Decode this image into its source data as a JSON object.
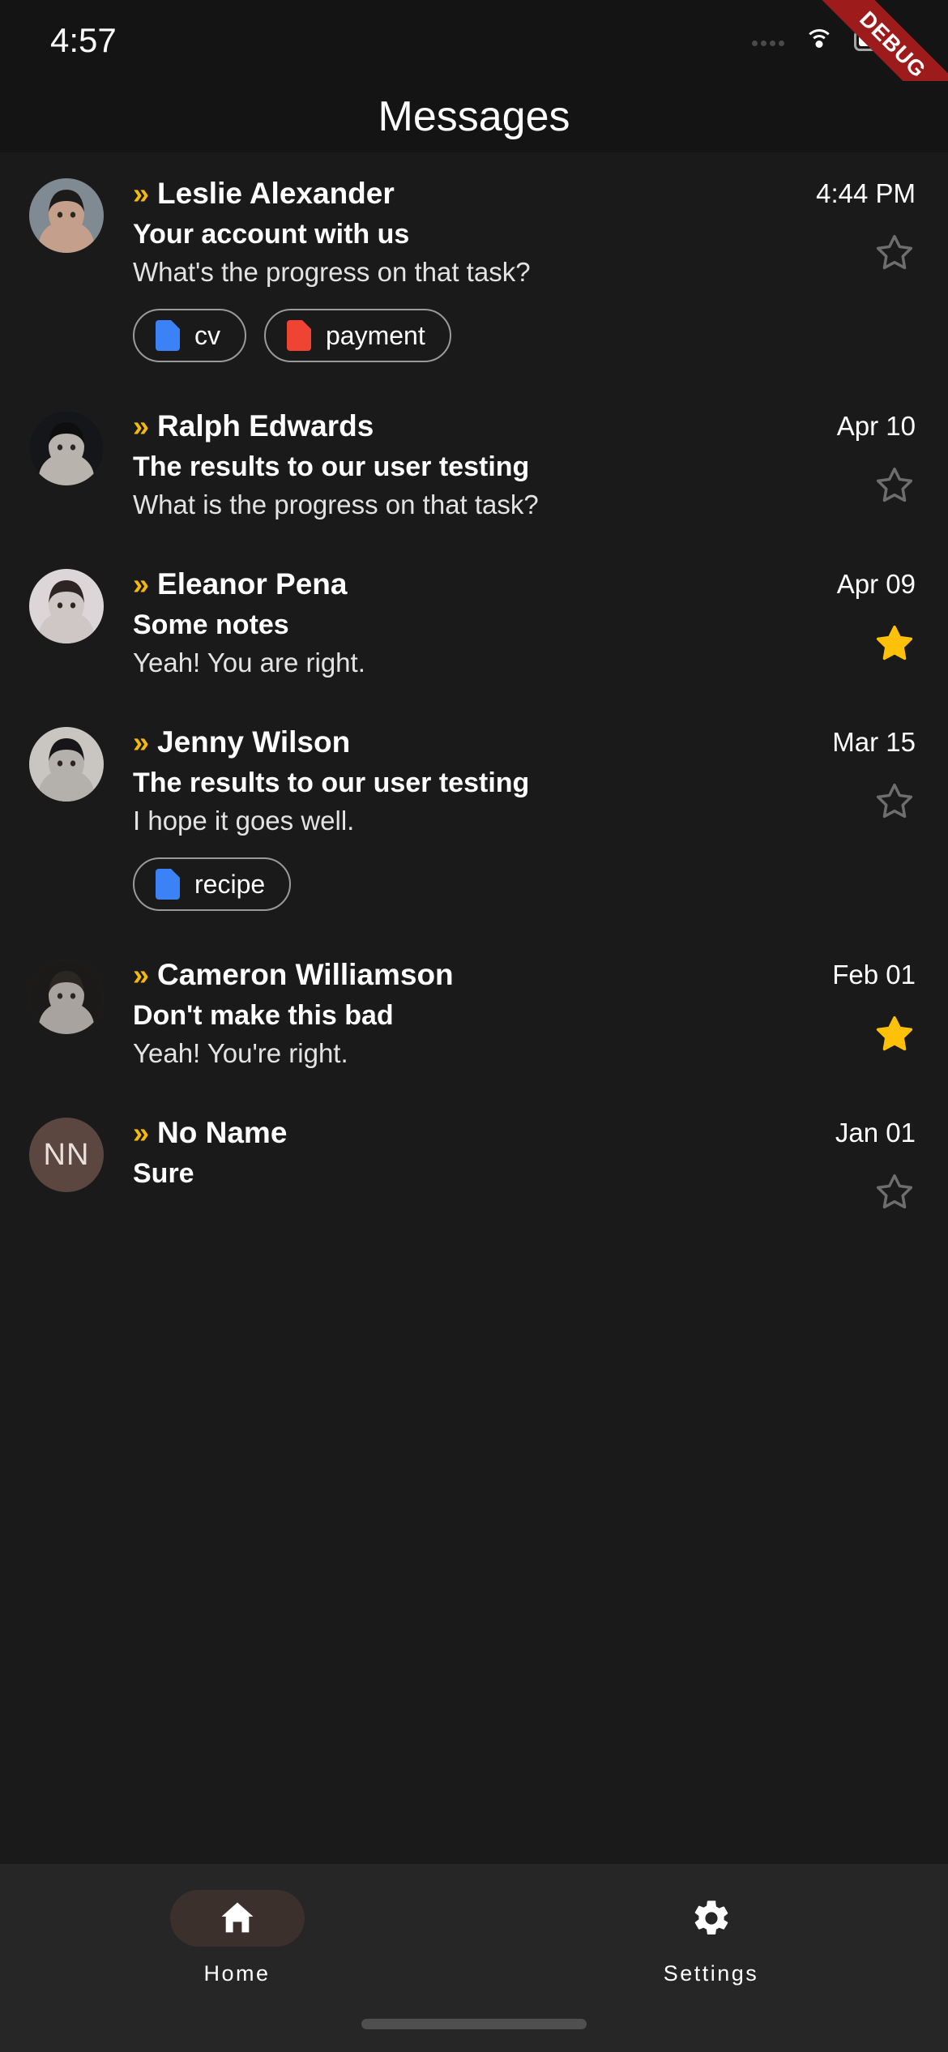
{
  "status_bar": {
    "time": "4:57",
    "icons": [
      "signal-dots",
      "wifi-icon",
      "battery-icon"
    ],
    "debug_banner": "DEBUG"
  },
  "app_bar": {
    "title": "Messages"
  },
  "messages": [
    {
      "avatar_type": "photo",
      "avatar_initials": "",
      "unread_icon": "»",
      "name": "Leslie Alexander",
      "date": "4:44 PM",
      "subject": "Your account with us",
      "preview": "What's the progress on that task?",
      "starred": false,
      "star_icon": "star-outline-icon",
      "attachments": [
        {
          "label": "cv",
          "color": "#3b82f6",
          "icon": "document-icon"
        },
        {
          "label": "payment",
          "color": "#ef4333",
          "icon": "document-icon"
        }
      ]
    },
    {
      "avatar_type": "photo",
      "avatar_initials": "",
      "unread_icon": "»",
      "name": "Ralph Edwards",
      "date": "Apr 10",
      "subject": "The results to our user testing",
      "preview": "What is the progress on that task?",
      "starred": false,
      "star_icon": "star-outline-icon",
      "attachments": []
    },
    {
      "avatar_type": "photo",
      "avatar_initials": "",
      "unread_icon": "»",
      "name": "Eleanor Pena",
      "date": "Apr 09",
      "subject": "Some notes",
      "preview": "Yeah! You are right.",
      "starred": true,
      "star_icon": "star-filled-icon",
      "attachments": []
    },
    {
      "avatar_type": "photo",
      "avatar_initials": "",
      "unread_icon": "»",
      "name": "Jenny Wilson",
      "date": "Mar 15",
      "subject": "The results to our user testing",
      "preview": "I hope it goes well.",
      "starred": false,
      "star_icon": "star-outline-icon",
      "attachments": [
        {
          "label": "recipe",
          "color": "#3b82f6",
          "icon": "document-icon"
        }
      ]
    },
    {
      "avatar_type": "photo",
      "avatar_initials": "",
      "unread_icon": "»",
      "name": "Cameron Williamson",
      "date": "Feb 01",
      "subject": "Don't make this bad",
      "preview": "Yeah! You're right.",
      "starred": true,
      "star_icon": "star-filled-icon",
      "attachments": []
    },
    {
      "avatar_type": "initials",
      "avatar_initials": "NN",
      "unread_icon": "»",
      "name": "No Name",
      "date": "Jan 01",
      "subject": "Sure",
      "preview": "",
      "starred": false,
      "star_icon": "star-outline-icon",
      "attachments": []
    }
  ],
  "bottom_nav": {
    "items": [
      {
        "label": "Home",
        "icon": "home-icon",
        "active": true
      },
      {
        "label": "Settings",
        "icon": "gear-icon",
        "active": false
      }
    ]
  },
  "colors": {
    "background": "#1a1a1a",
    "header": "#141414",
    "nav_background": "#262626",
    "accent_chevron": "#f5b90a",
    "star_filled": "#FFC107",
    "star_outline": "#6e6e6e",
    "debug_banner": "#9e1b1b",
    "active_pill": "#3b302c"
  }
}
